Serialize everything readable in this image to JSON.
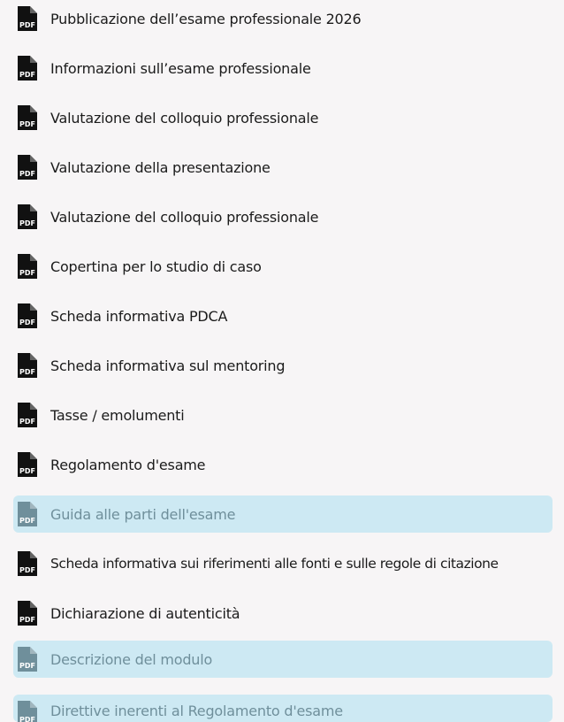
{
  "icon": {
    "name": "pdf-icon",
    "text": "PDF",
    "color": "#111111",
    "highlight_color": "#6f8f9b"
  },
  "highlight_background": "#cde9f3",
  "items": [
    {
      "label": "Pubblicazione dell’esame professionale 2026",
      "highlighted": false
    },
    {
      "label": "Informazioni sull’esame professionale",
      "highlighted": false
    },
    {
      "label": "Valutazione del colloquio professionale",
      "highlighted": false
    },
    {
      "label": "Valutazione della presentazione",
      "highlighted": false
    },
    {
      "label": "Valutazione del colloquio professionale",
      "highlighted": false
    },
    {
      "label": "Copertina per lo studio di caso",
      "highlighted": false
    },
    {
      "label": "Scheda informativa PDCA",
      "highlighted": false
    },
    {
      "label": "Scheda informativa sul mentoring",
      "highlighted": false
    },
    {
      "label": "Tasse / emolumenti",
      "highlighted": false
    },
    {
      "label": "Regolamento d'esame",
      "highlighted": false
    },
    {
      "label": "Guida alle parti dell'esame",
      "highlighted": true
    },
    {
      "label": "Scheda informativa sui riferimenti alle fonti e sulle regole di citazione",
      "highlighted": false
    },
    {
      "label": "Dichiarazione di autenticità",
      "highlighted": false
    },
    {
      "label": "Descrizione del modulo",
      "highlighted": true
    },
    {
      "label": "Direttive inerenti al Regolamento d'esame",
      "highlighted": true
    }
  ]
}
